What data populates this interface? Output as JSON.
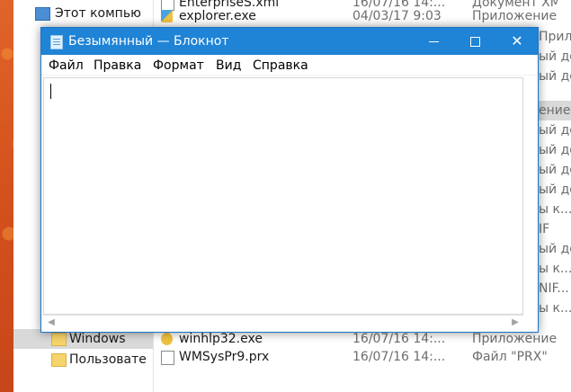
{
  "explorer": {
    "nav": {
      "top_item": "Этот компью",
      "windows": "Windows",
      "users": "Пользовате"
    },
    "files": [
      {
        "name": "EnterpriseS.xml",
        "date": "16/07/16 14:...",
        "type": "Документ XML"
      },
      {
        "name": "explorer.exe",
        "date": "04/03/17 9:03",
        "type": "Приложение"
      },
      {
        "name": "winhlp32.exe",
        "date": "16/07/16 14:...",
        "type": "Приложение"
      },
      {
        "name": "WMSysPr9.prx",
        "date": "16/07/16 14:...",
        "type": "Файл \"PRX\""
      }
    ],
    "right_types": [
      "Приложение",
      "ый до...",
      "ый до...",
      "ение",
      "ый до...",
      "ый до...",
      "ый до...",
      "ый до...",
      "ы к...",
      "IF",
      "ый до...",
      "ы к...",
      "NIF...",
      "ы к..."
    ]
  },
  "notepad": {
    "title": "Безымянный — Блокнот",
    "menu": [
      "Файл",
      "Правка",
      "Формат",
      "Вид",
      "Справка"
    ],
    "text": "",
    "controls": {
      "minimize_icon": "minimize-icon",
      "maximize_icon": "maximize-icon",
      "close_icon": "close-icon",
      "close_glyph": "✕"
    },
    "colors": {
      "titlebar": "#1f83d6",
      "border": "#1a73c9"
    }
  }
}
